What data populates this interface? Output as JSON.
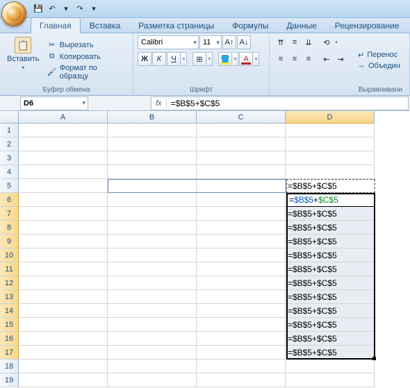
{
  "qat": {
    "save": "💾",
    "undo": "↶",
    "redo": "↷",
    "more": "▾"
  },
  "tabs": {
    "home": "Главная",
    "insert": "Вставка",
    "layout": "Разметка страницы",
    "formulas": "Формулы",
    "data": "Данные",
    "review": "Рецензирование"
  },
  "clipboard": {
    "paste": "Вставить",
    "cut": "Вырезать",
    "copy": "Копировать",
    "format": "Формат по образцу",
    "group": "Буфер обмена"
  },
  "font": {
    "name": "Calibri",
    "size": "11",
    "group": "Шрифт",
    "bold": "Ж",
    "italic": "К",
    "underline": "Ч"
  },
  "align": {
    "group": "Выравнивани",
    "wrap": "Перенос",
    "merge": "Объедин"
  },
  "namebox": "D6",
  "formula": "=$B$5+$C$5",
  "cols": [
    "A",
    "B",
    "C",
    "D"
  ],
  "rows": [
    "1",
    "2",
    "3",
    "4",
    "5",
    "6",
    "7",
    "8",
    "9",
    "10",
    "11",
    "12",
    "13",
    "14",
    "15",
    "16",
    "17",
    "18",
    "19"
  ],
  "d5": "=$B$5+$C$5",
  "d6_p1": "=",
  "d6_p2": "$B$5",
  "d6_p3": "+",
  "d6_p4": "$C$5",
  "fill": [
    "=$B$5+$C$5",
    "=$B$5+$C$5",
    "=$B$5+$C$5",
    "=$B$5+$C$5",
    "=$B$5+$C$5",
    "=$B$5+$C$5",
    "=$B$5+$C$5",
    "=$B$5+$C$5",
    "=$B$5+$C$5",
    "=$B$5+$C$5",
    "=$B$5+$C$5"
  ]
}
